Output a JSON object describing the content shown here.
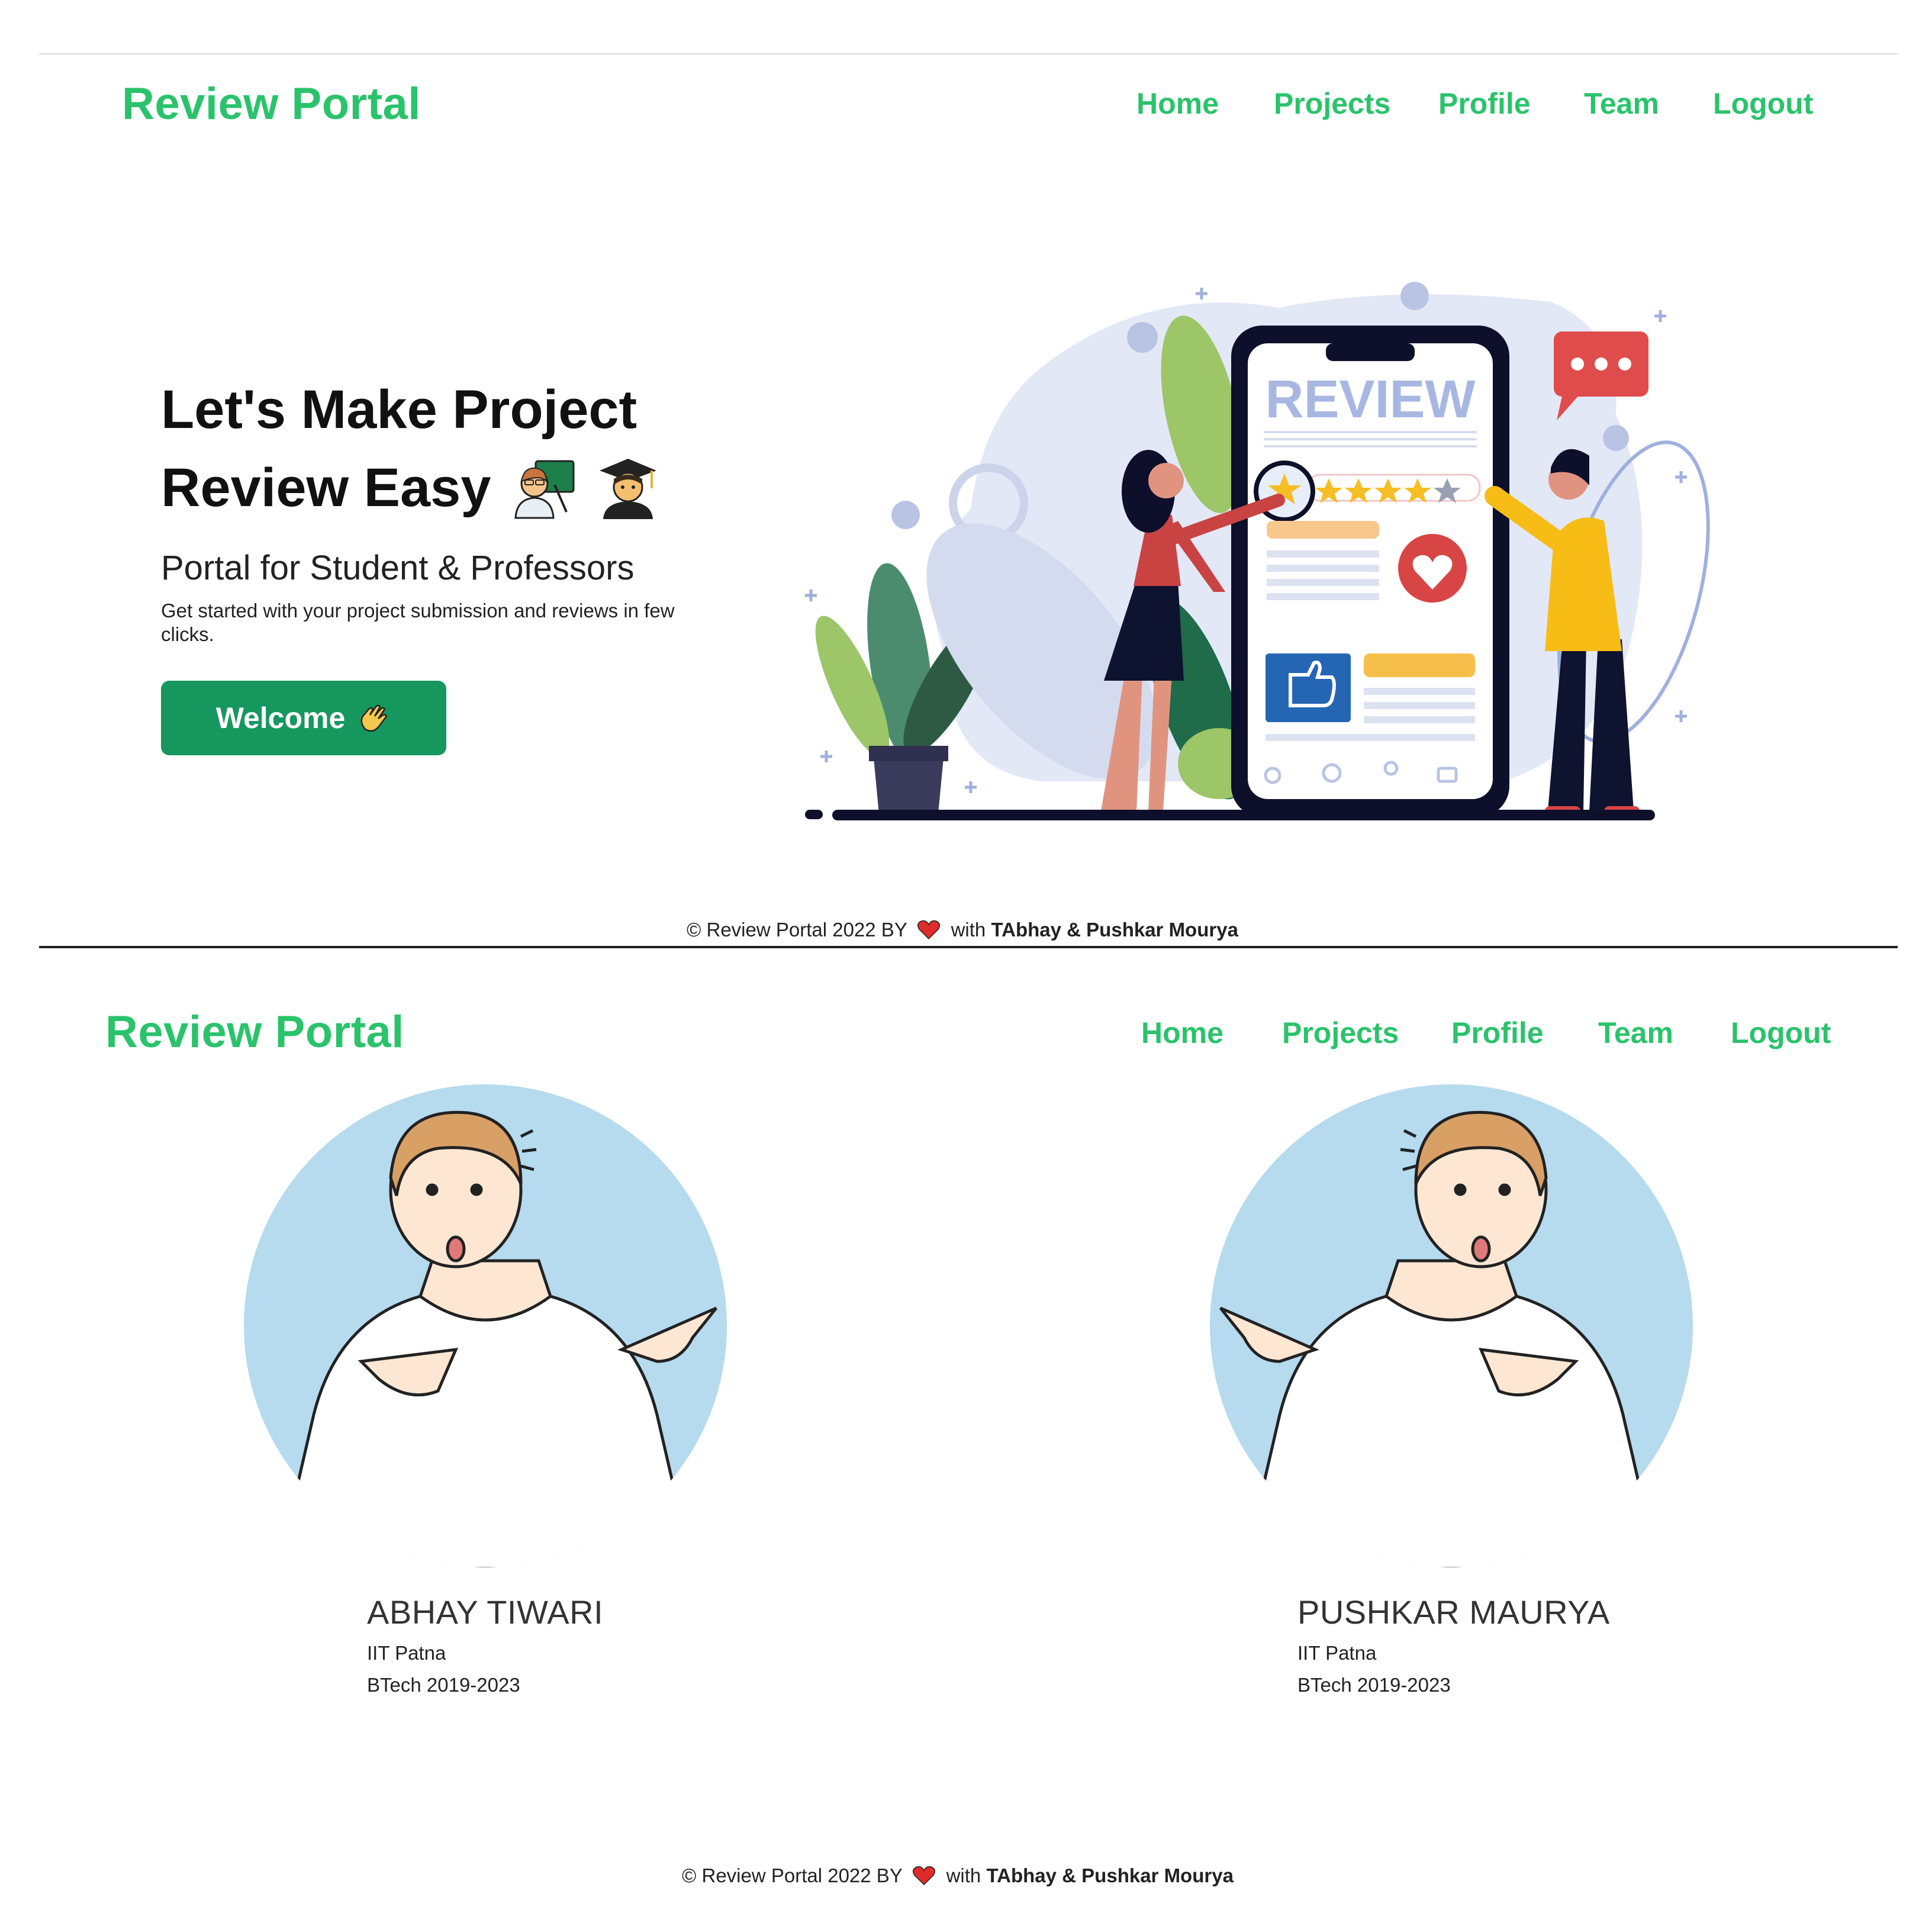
{
  "section1": {
    "brand": "Review Portal",
    "nav": [
      "Home",
      "Projects",
      "Profile",
      "Team",
      "Logout"
    ],
    "hero": {
      "title_line1": "Let's Make Project",
      "title_line2": "Review Easy",
      "subtitle": "Portal for Student & Professors",
      "description_line1": "Get started with your project submission and reviews in few",
      "description_line2": "clicks.",
      "button_label": "Welcome",
      "illustration_text": "REVIEW"
    },
    "footer": {
      "prefix": "© Review Portal 2022  BY",
      "middle": "with",
      "authors": "TAbhay & Pushkar Mourya"
    }
  },
  "section2": {
    "brand": "Review Portal",
    "nav": [
      "Home",
      "Projects",
      "Profile",
      "Team",
      "Logout"
    ],
    "members": [
      {
        "name": "ABHAY TIWARI",
        "institute": "IIT Patna",
        "program": "BTech 2019-2023"
      },
      {
        "name": "PUSHKAR MAURYA",
        "institute": "IIT Patna",
        "program": "BTech 2019-2023"
      }
    ],
    "footer": {
      "prefix": "© Review Portal 2022  BY",
      "middle": "with",
      "authors": "TAbhay & Pushkar Mourya"
    }
  },
  "colors": {
    "accent": "#2ac36b",
    "button": "#16975e",
    "avatar_bg": "#b6daee"
  }
}
